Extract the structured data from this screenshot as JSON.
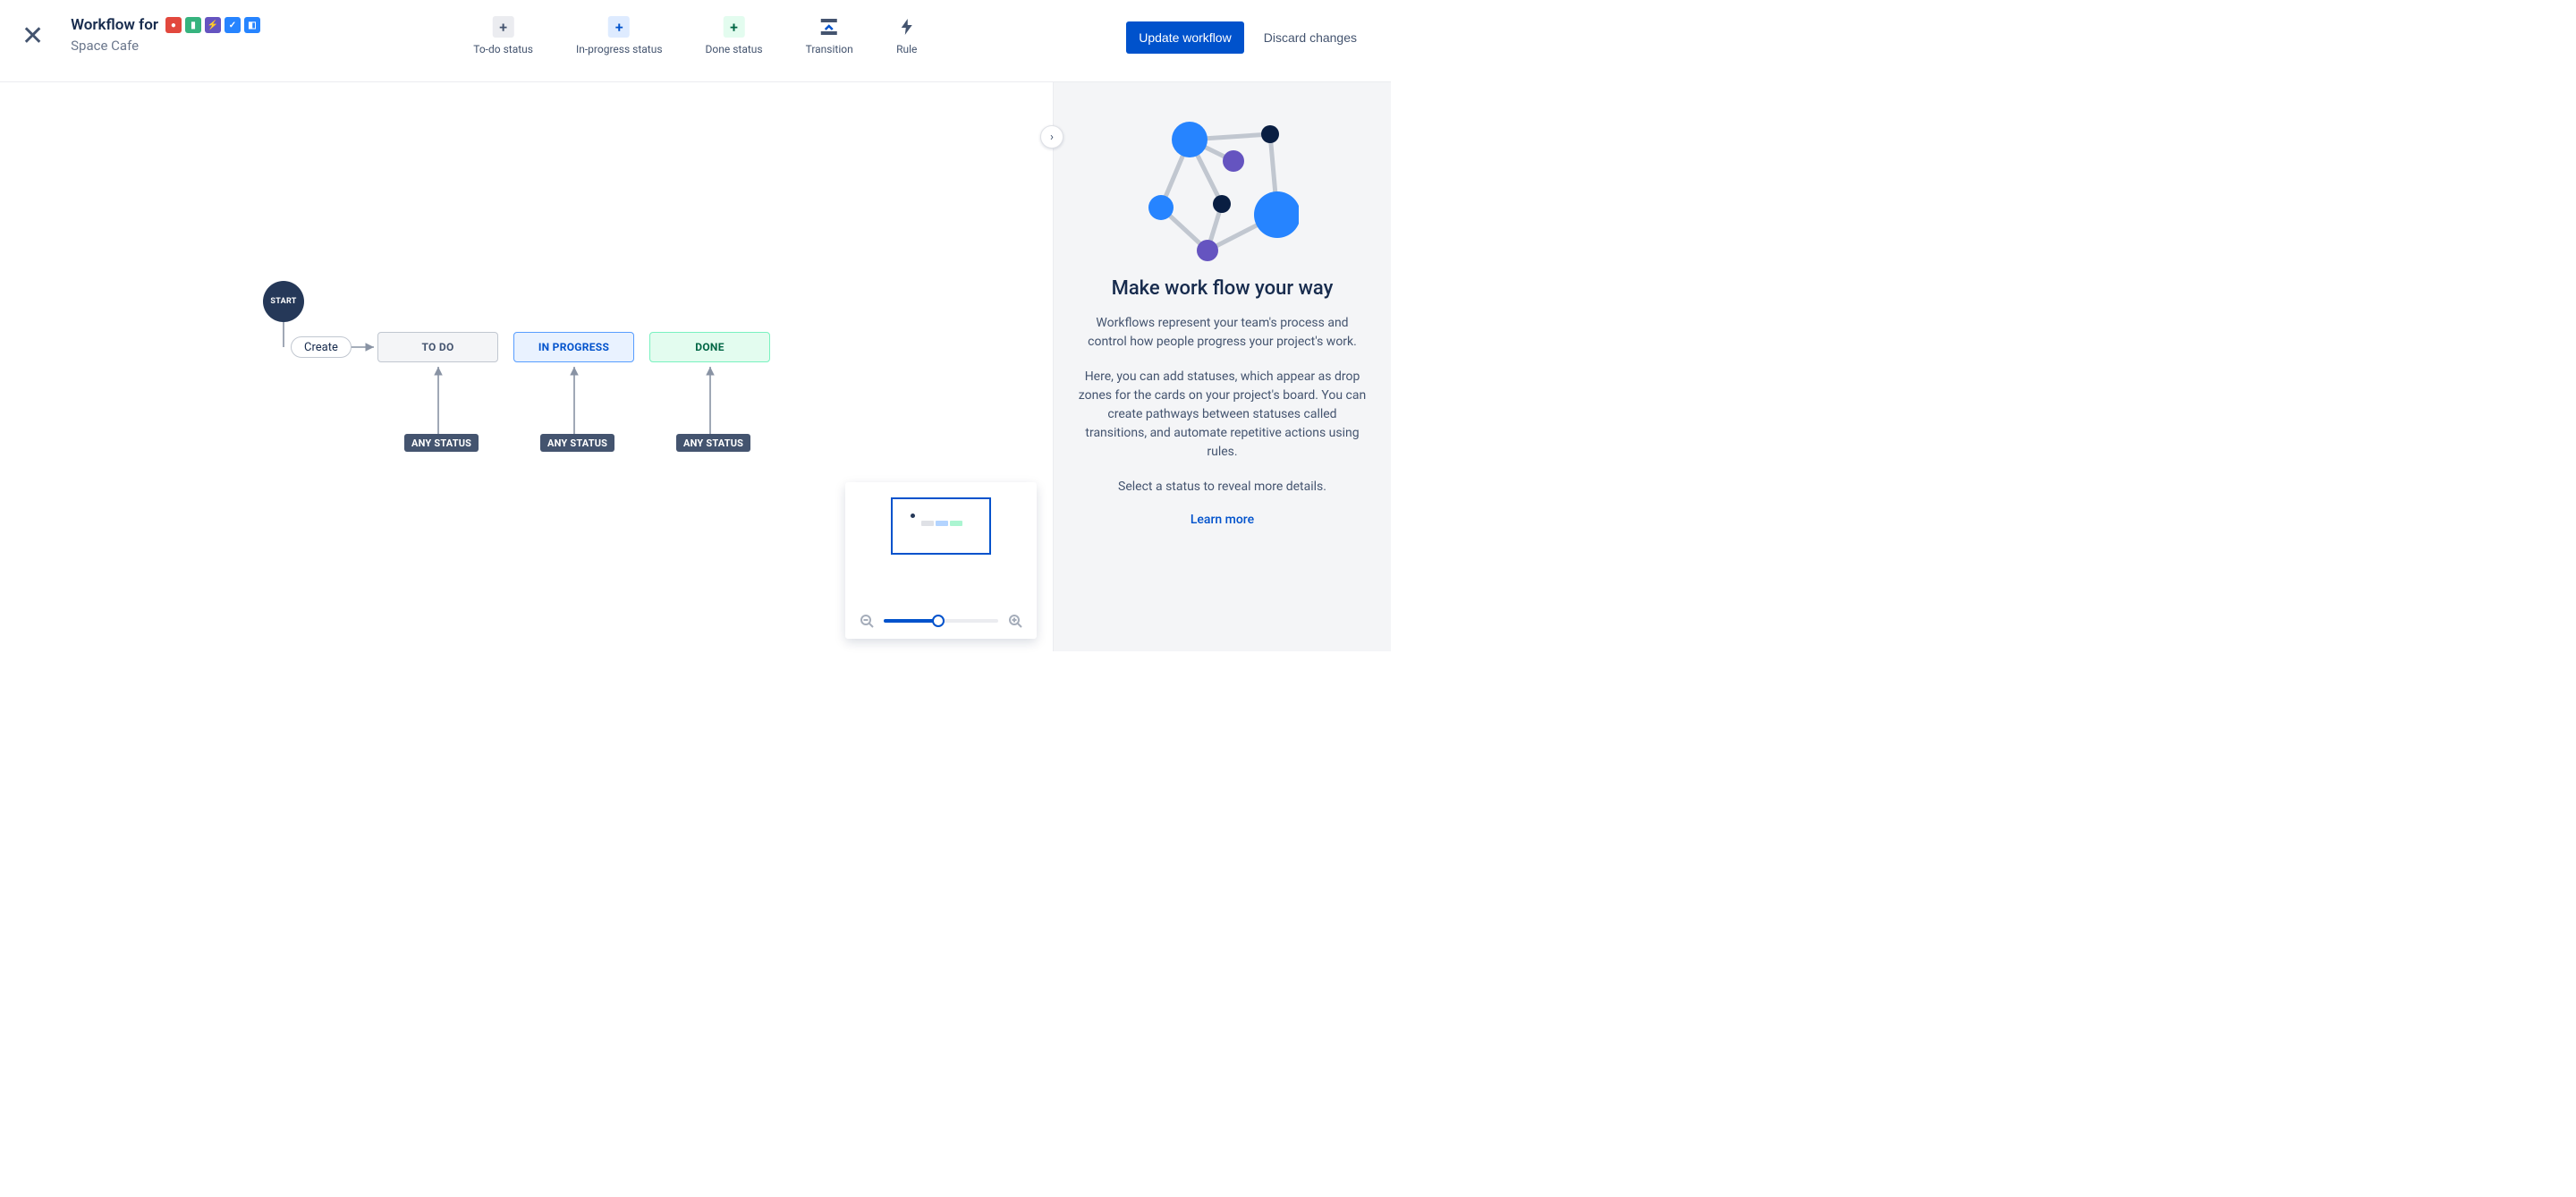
{
  "header": {
    "title_prefix": "Workflow for",
    "subtitle": "Space Cafe",
    "icons": [
      "bug",
      "story",
      "epic",
      "task",
      "subtask"
    ]
  },
  "toolbar": {
    "todo_label": "To-do status",
    "inprogress_label": "In-progress status",
    "done_label": "Done status",
    "transition_label": "Transition",
    "rule_label": "Rule"
  },
  "actions": {
    "update_label": "Update workflow",
    "discard_label": "Discard changes"
  },
  "canvas": {
    "start_label": "START",
    "create_pill": "Create",
    "statuses": {
      "todo": "TO DO",
      "in_progress": "IN PROGRESS",
      "done": "DONE"
    },
    "any_status_label": "ANY STATUS"
  },
  "panel": {
    "heading": "Make work flow your way",
    "p1": "Workflows represent your team's process and control how people progress your project's work.",
    "p2": "Here, you can add statuses, which appear as drop zones for the cards on your project's board. You can create pathways between statuses called transitions, and automate repetitive actions using rules.",
    "p3": "Select a status to reveal more details.",
    "learn_more": "Learn more"
  },
  "zoom": {
    "percent": 48
  }
}
